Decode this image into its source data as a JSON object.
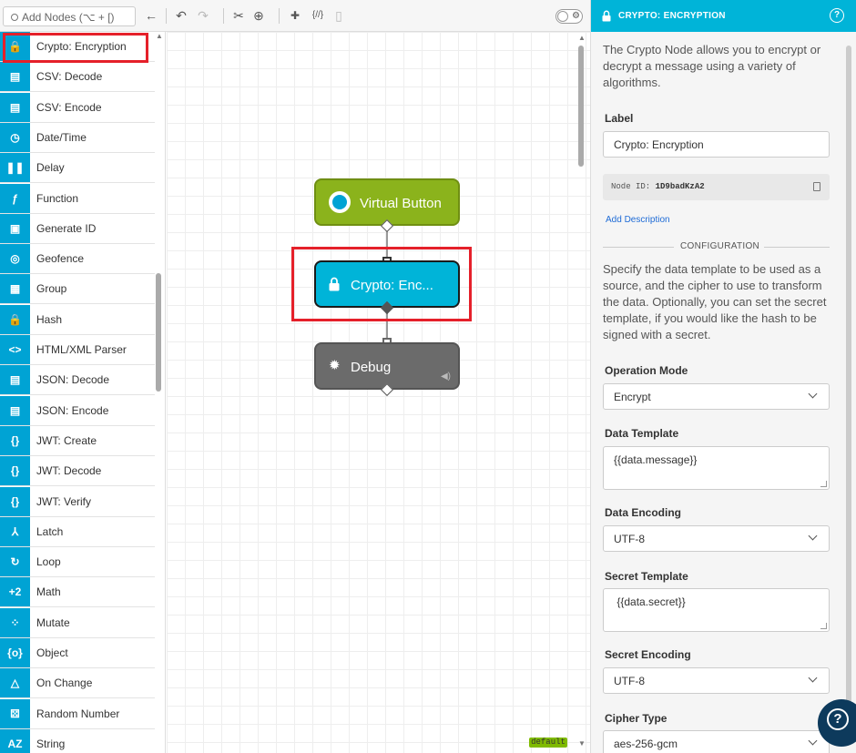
{
  "toolbar": {
    "search_placeholder": "Add Nodes (⌥ + [)",
    "back_icon": "←",
    "undo_icon": "↶",
    "redo_icon": "↷",
    "cut_icon": "✂",
    "zoom_icon": "⊕",
    "add_note_icon": "✚",
    "code_icon": "{//}",
    "frame_icon": "▯"
  },
  "palette": {
    "items": [
      {
        "label": "Crypto: Encryption",
        "icon": "🔒"
      },
      {
        "label": "CSV: Decode",
        "icon": "▤"
      },
      {
        "label": "CSV: Encode",
        "icon": "▤"
      },
      {
        "label": "Date/Time",
        "icon": "◷"
      },
      {
        "label": "Delay",
        "icon": "❚❚"
      },
      {
        "label": "Function",
        "icon": "ƒ"
      },
      {
        "label": "Generate ID",
        "icon": "▣"
      },
      {
        "label": "Geofence",
        "icon": "◎"
      },
      {
        "label": "Group",
        "icon": "▦"
      },
      {
        "label": "Hash",
        "icon": "🔒"
      },
      {
        "label": "HTML/XML Parser",
        "icon": "<>"
      },
      {
        "label": "JSON: Decode",
        "icon": "▤"
      },
      {
        "label": "JSON: Encode",
        "icon": "▤"
      },
      {
        "label": "JWT: Create",
        "icon": "{}"
      },
      {
        "label": "JWT: Decode",
        "icon": "{}"
      },
      {
        "label": "JWT: Verify",
        "icon": "{}"
      },
      {
        "label": "Latch",
        "icon": "⅄"
      },
      {
        "label": "Loop",
        "icon": "↻"
      },
      {
        "label": "Math",
        "icon": "+2"
      },
      {
        "label": "Mutate",
        "icon": "⁘"
      },
      {
        "label": "Object",
        "icon": "{o}"
      },
      {
        "label": "On Change",
        "icon": "△"
      },
      {
        "label": "Random Number",
        "icon": "⚄"
      },
      {
        "label": "String",
        "icon": "AZ"
      }
    ]
  },
  "canvas": {
    "nodes": {
      "virtual_button": "Virtual Button",
      "crypto": "Crypto: Enc...",
      "debug": "Debug"
    },
    "flow_badge": "default"
  },
  "panel": {
    "title": "CRYPTO: ENCRYPTION",
    "help_icon": "?",
    "intro": "The Crypto Node allows you to encrypt or decrypt a message using a variety of algorithms.",
    "label_heading": "Label",
    "label_value": "Crypto: Encryption",
    "node_id_label": "Node ID:",
    "node_id_value": "1D9badKzA2",
    "add_description": "Add Description",
    "configuration_title": "CONFIGURATION",
    "configuration_text": "Specify the data template to be used as a source, and the cipher to use to transform the data. Optionally, you can set the secret template, if you would like the hash to be signed with a secret.",
    "operation_mode_label": "Operation Mode",
    "operation_mode_value": "Encrypt",
    "data_template_label": "Data Template",
    "data_template_value": "{{data.message}}",
    "data_encoding_label": "Data Encoding",
    "data_encoding_value": "UTF-8",
    "secret_template_label": "Secret Template",
    "secret_template_value": " {{data.secret}}",
    "secret_encoding_label": "Secret Encoding",
    "secret_encoding_value": "UTF-8",
    "cipher_type_label": "Cipher Type",
    "cipher_type_value": "aes-256-gcm"
  },
  "colors": {
    "accent": "#00b4d8",
    "palette_icon_bg": "#00a3d4",
    "virtual_button_node": "#8bb31c",
    "debug_node": "#6b6b6b",
    "highlight": "#e5202a",
    "help_fab": "#0d3a5c"
  }
}
